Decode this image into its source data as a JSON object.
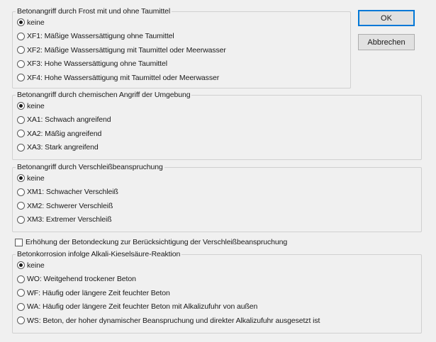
{
  "buttons": {
    "ok": "OK",
    "cancel": "Abbrechen"
  },
  "groups": [
    {
      "key": "frost",
      "legend": "Betonangriff durch Frost mit und ohne Taumittel",
      "options": [
        {
          "label": "keine",
          "checked": true
        },
        {
          "label": "XF1: Mäßige Wassersättigung ohne Taumittel",
          "checked": false
        },
        {
          "label": "XF2: Mäßige Wassersättigung mit Taumittel oder Meerwasser",
          "checked": false
        },
        {
          "label": "XF3: Hohe Wassersättigung ohne Taumittel",
          "checked": false
        },
        {
          "label": "XF4: Hohe Wassersättigung mit Taumittel oder Meerwasser",
          "checked": false
        }
      ]
    },
    {
      "key": "chemisch",
      "legend": "Betonangriff durch chemischen Angriff der Umgebung",
      "options": [
        {
          "label": "keine",
          "checked": true
        },
        {
          "label": "XA1: Schwach angreifend",
          "checked": false
        },
        {
          "label": "XA2: Mäßig angreifend",
          "checked": false
        },
        {
          "label": "XA3: Stark angreifend",
          "checked": false
        }
      ]
    },
    {
      "key": "verschleiss",
      "legend": "Betonangriff durch Verschleißbeanspruchung",
      "options": [
        {
          "label": "keine",
          "checked": true
        },
        {
          "label": "XM1: Schwacher Verschleiß",
          "checked": false
        },
        {
          "label": "XM2: Schwerer Verschleiß",
          "checked": false
        },
        {
          "label": "XM3: Extremer Verschleiß",
          "checked": false
        }
      ]
    },
    {
      "key": "alkali",
      "legend": "Betonkorrosion infolge Alkali-Kieselsäure-Reaktion",
      "options": [
        {
          "label": "keine",
          "checked": true
        },
        {
          "label": "WO: Weitgehend trockener Beton",
          "checked": false
        },
        {
          "label": "WF: Häufig oder längere Zeit feuchter Beton",
          "checked": false
        },
        {
          "label": "WA: Häufig oder längere Zeit feuchter Beton mit Alkalizufuhr von außen",
          "checked": false
        },
        {
          "label": "WS: Beton, der hoher dynamischer Beanspruchung und direkter Alkalizufuhr ausgesetzt ist",
          "checked": false
        }
      ]
    }
  ],
  "checkbox": {
    "label": "Erhöhung der Betondeckung zur Berücksichtigung der Verschleißbeanspruchung",
    "checked": false
  }
}
